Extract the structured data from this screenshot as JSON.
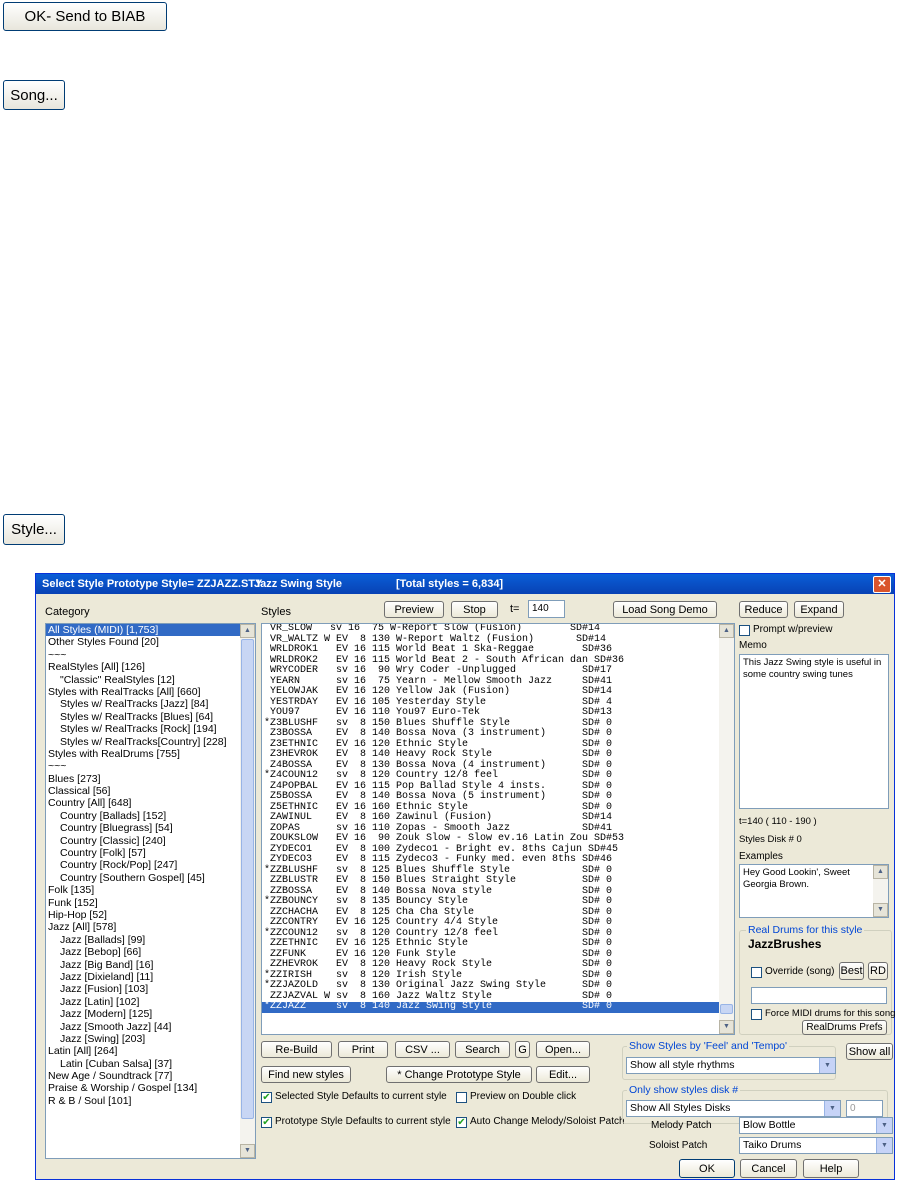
{
  "top_buttons": {
    "send": "OK- Send to BIAB",
    "song": "Song...",
    "style": "Style..."
  },
  "dialog": {
    "title": "Select Style Prototype Style= ZZJAZZ.STY",
    "style_name": "Jazz Swing Style",
    "total": "[Total styles = 6,834]",
    "close": "✕",
    "category_label": "Category",
    "styles_label": "Styles",
    "categories": [
      "All Styles (MIDI) [1,753]",
      "Other Styles Found [20]",
      "~~~",
      "RealStyles [All] [126]",
      "\"Classic\" RealStyles [12]",
      "Styles with RealTracks [All] [660]",
      "Styles w/ RealTracks [Jazz] [84]",
      "Styles w/ RealTracks [Blues] [64]",
      "Styles w/ RealTracks [Rock] [194]",
      "Styles w/ RealTracks[Country] [228]",
      "Styles with RealDrums [755]",
      "~~~",
      "Blues [273]",
      "Classical [56]",
      "Country [All] [648]",
      "Country [Ballads] [152]",
      "Country [Bluegrass] [54]",
      "Country [Classic] [240]",
      "Country [Folk] [57]",
      "Country [Rock/Pop] [247]",
      "Country [Southern Gospel] [45]",
      "Folk [135]",
      "Funk [152]",
      "Hip-Hop [52]",
      "Jazz [All] [578]",
      "Jazz [Ballads] [99]",
      "Jazz [Bebop] [66]",
      "Jazz [Big Band] [16]",
      "Jazz [Dixieland] [11]",
      "Jazz [Fusion] [103]",
      "Jazz [Latin] [102]",
      "Jazz [Modern] [125]",
      "Jazz [Smooth Jazz] [44]",
      "Jazz [Swing] [203]",
      "Latin [All] [264]",
      "Latin [Cuban Salsa] [37]",
      "New Age / Soundtrack [77]",
      "Praise & Worship / Gospel [134]",
      "R & B / Soul [101]"
    ],
    "styles": [
      " VR_SLOW   sv 16  75 W-Report Slow (Fusion)        SD#14",
      " VR_WALTZ W EV  8 130 W-Report Waltz (Fusion)       SD#14",
      " WRLDROK1   EV 16 115 World Beat 1 Ska-Reggae        SD#36",
      " WRLDROK2   EV 16 115 World Beat 2 - South African dan SD#36",
      " WRYCODER   sv 16  90 Wry Coder -Unplugged           SD#17",
      " YEARN      sv 16  75 Yearn - Mellow Smooth Jazz     SD#41",
      " YELOWJAK   EV 16 120 Yellow Jak (Fusion)            SD#14",
      " YESTRDAY   EV 16 105 Yesterday Style                SD# 4",
      " YOU97      EV 16 110 You97 Euro-Tek                 SD#13",
      "*Z3BLUSHF   sv  8 150 Blues Shuffle Style            SD# 0",
      " Z3BOSSA    EV  8 140 Bossa Nova (3 instrument)      SD# 0",
      " Z3ETHNIC   EV 16 120 Ethnic Style                   SD# 0",
      " Z3HEVROK   EV  8 140 Heavy Rock Style               SD# 0",
      " Z4BOSSA    EV  8 130 Bossa Nova (4 instrument)      SD# 0",
      "*Z4COUN12   sv  8 120 Country 12/8 feel              SD# 0",
      " Z4POPBAL   EV 16 115 Pop Ballad Style 4 insts.      SD# 0",
      " Z5BOSSA    EV  8 140 Bossa Nova (5 instrument)      SD# 0",
      " Z5ETHNIC   EV 16 160 Ethnic Style                   SD# 0",
      " ZAWINUL    EV  8 160 Zawinul (Fusion)               SD#14",
      " ZOPAS      sv 16 110 Zopas - Smooth Jazz            SD#41",
      " ZOUKSLOW   EV 16  90 Zouk Slow - Slow ev.16 Latin Zou SD#53",
      " ZYDECO1    EV  8 100 Zydeco1 - Bright ev. 8ths Cajun SD#45",
      " ZYDECO3    EV  8 115 Zydeco3 - Funky med. even 8ths SD#46",
      "*ZZBLUSHF   sv  8 125 Blues Shuffle Style            SD# 0",
      " ZZBLUSTR   EV  8 150 Blues Straight Style           SD# 0",
      " ZZBOSSA    EV  8 140 Bossa Nova style               SD# 0",
      "*ZZBOUNCY   sv  8 135 Bouncy Style                   SD# 0",
      " ZZCHACHA   EV  8 125 Cha Cha Style                  SD# 0",
      " ZZCONTRY   EV 16 125 Country 4/4 Style              SD# 0",
      "*ZZCOUN12   sv  8 120 Country 12/8 feel              SD# 0",
      " ZZETHNIC   EV 16 125 Ethnic Style                   SD# 0",
      " ZZFUNK     EV 16 120 Funk Style                     SD# 0",
      " ZZHEVROK   EV  8 120 Heavy Rock Style               SD# 0",
      "*ZZIRISH    sv  8 120 Irish Style                    SD# 0",
      "*ZZJAZOLD   sv  8 130 Original Jazz Swing Style      SD# 0",
      " ZZJAZVAL W sv  8 160 Jazz Waltz Style               SD# 0",
      "*ZZJAZZ     sv  8 140 Jazz Swing Style               SD# 0"
    ],
    "buttons": {
      "preview": "Preview",
      "stop": "Stop",
      "tempo_label": "t=",
      "tempo_value": "140",
      "load_song_demo": "Load Song Demo",
      "reduce": "Reduce",
      "expand": "Expand",
      "rebuild": "Re-Build",
      "print": "Print",
      "csv": "CSV ...",
      "search": "Search",
      "g": "G",
      "open": "Open...",
      "find_new": "Find new styles",
      "change_proto": "* Change Prototype Style",
      "edit": "Edit...",
      "show_all": "Show all",
      "best": "Best",
      "rd": "RD",
      "realdrums_prefs": "RealDrums Prefs",
      "ok": "OK",
      "cancel": "Cancel",
      "help": "Help"
    },
    "right": {
      "prompt_preview": "Prompt w/preview",
      "memo_label": "Memo",
      "memo_text": "This Jazz Swing style is useful in some country swing tunes",
      "tempo_range": "t=140 ( 110 - 190 )",
      "styles_disk": "Styles Disk # 0",
      "examples_label": "Examples",
      "examples_text": "Hey Good Lookin', Sweet Georgia Brown.",
      "real_drums_group": "Real Drums for this style",
      "real_drums_name": "JazzBrushes",
      "override": "Override (song)",
      "force_midi": "Force MIDI drums for this song"
    },
    "checks": {
      "selected_defaults": "Selected Style Defaults to current style",
      "prototype_defaults": "Prototype Style Defaults to current style",
      "preview_double": "Preview on Double click",
      "auto_change": "Auto Change Melody/Soloist Patch"
    },
    "filters": {
      "feel_group": "Show Styles by 'Feel' and 'Tempo'",
      "feel_value": "Show all style rhythms",
      "disk_group": "Only show styles disk #",
      "disk_value": "Show All Styles Disks",
      "disk_num": "0",
      "melody_label": "Melody Patch",
      "melody_value": "Blow Bottle",
      "soloist_label": "Soloist Patch",
      "soloist_value": "Taiko Drums"
    }
  }
}
